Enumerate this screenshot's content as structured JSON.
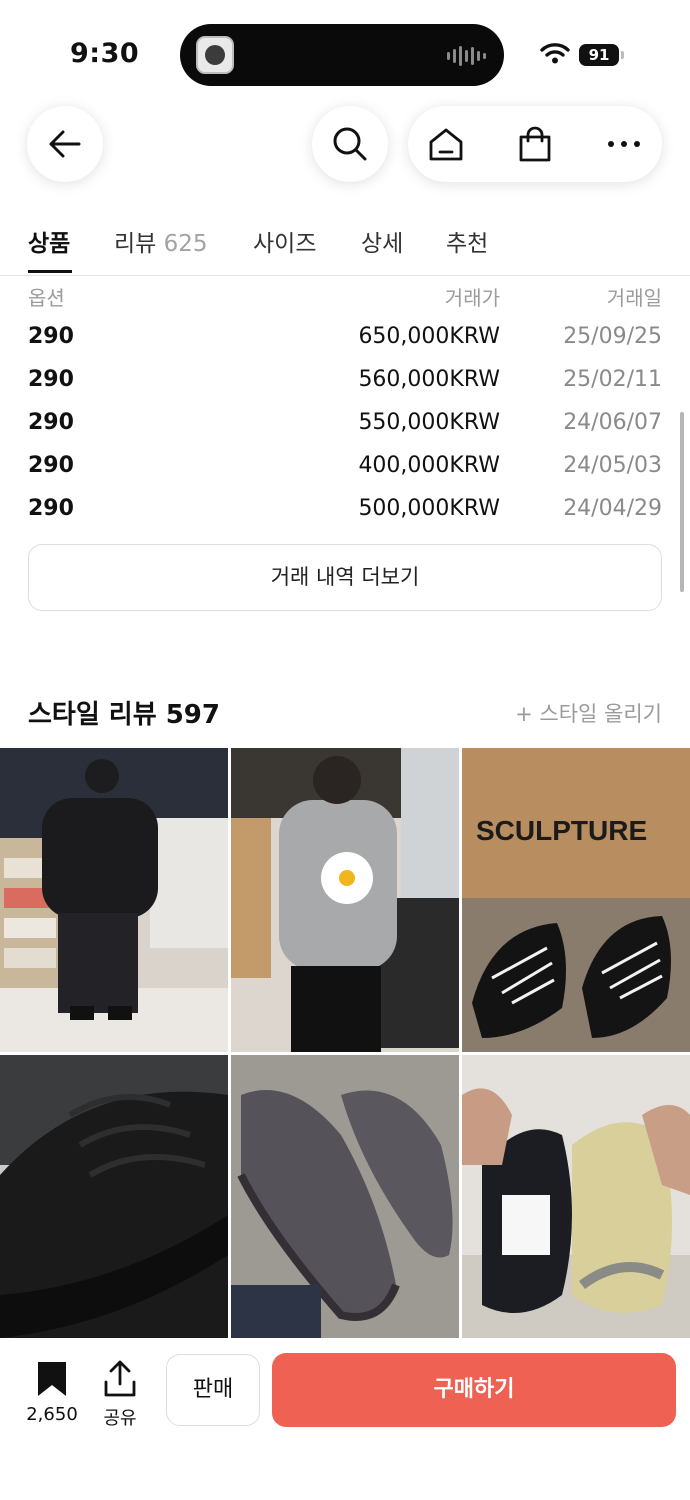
{
  "status_bar": {
    "time": "9:30",
    "battery": "91"
  },
  "tabs": [
    {
      "label": "상품"
    },
    {
      "label": "리뷰",
      "count": "625"
    },
    {
      "label": "사이즈"
    },
    {
      "label": "상세"
    },
    {
      "label": "추천"
    }
  ],
  "trade_history": {
    "headers": {
      "option": "옵션",
      "price": "거래가",
      "date": "거래일"
    },
    "rows": [
      {
        "option": "290",
        "price": "650,000KRW",
        "date": "25/09/25"
      },
      {
        "option": "290",
        "price": "560,000KRW",
        "date": "25/02/11"
      },
      {
        "option": "290",
        "price": "550,000KRW",
        "date": "24/06/07"
      },
      {
        "option": "290",
        "price": "400,000KRW",
        "date": "24/05/03"
      },
      {
        "option": "290",
        "price": "500,000KRW",
        "date": "24/04/29"
      }
    ],
    "more_label": "거래 내역 더보기"
  },
  "style_review": {
    "title": "스타일 리뷰 597",
    "upload_label": "+ 스타일 올리기",
    "photo_texts": [
      "SCULPTURE"
    ]
  },
  "bottom_bar": {
    "bookmark_count": "2,650",
    "share_label": "공유",
    "sell_label": "판매",
    "buy_label": "구매하기"
  },
  "colors": {
    "buy_button": "#ef6253",
    "text_primary": "#111111",
    "text_secondary": "#9b9b9b"
  }
}
